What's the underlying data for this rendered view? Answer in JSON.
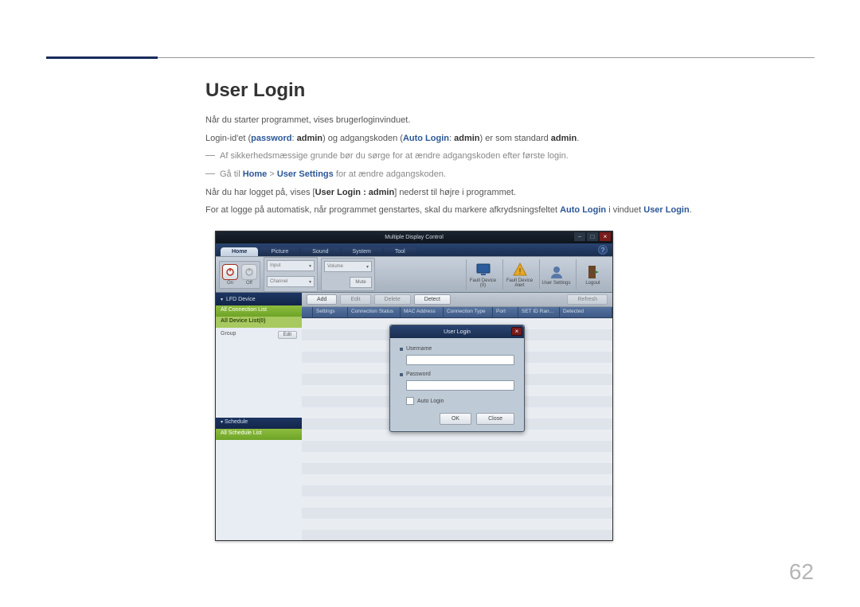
{
  "heading": "User Login",
  "intro": {
    "p1": "Når du starter programmet, vises brugerloginvinduet.",
    "p2": {
      "prefix": "Login-id'et (",
      "pw_label": "password",
      "colon1": ": ",
      "admin1": "admin",
      "mid": ") og adgangskoden (",
      "al_label": "Auto Login",
      "colon2": ": ",
      "admin2": "admin",
      "mid2": ") er som standard ",
      "admin3": "admin",
      "end": "."
    },
    "note1": "Af sikkerhedsmæssige grunde bør du sørge for at ændre adgangskoden efter første login.",
    "note2": {
      "prefix": "Gå til ",
      "home": "Home",
      "gt": " > ",
      "us": "User Settings",
      "suffix": " for at ændre adgangskoden."
    },
    "p3": {
      "prefix": "Når du har logget på, vises [",
      "ul": "User Login : admin",
      "suffix": "] nederst til højre i programmet."
    },
    "p4": {
      "prefix": "For at logge på automatisk, når programmet genstartes, skal du markere afkrydsningsfeltet ",
      "al": "Auto Login",
      "mid": " i vinduet ",
      "ul": "User Login",
      "end": "."
    }
  },
  "app": {
    "title": "Multiple Display Control",
    "tabs": [
      "Home",
      "Picture",
      "Sound",
      "System",
      "Tool"
    ],
    "toolbar": {
      "on": "On",
      "off": "Off",
      "input": "Input",
      "channel": "Channel",
      "volume": "Volume",
      "mute": "Mute",
      "fault_device": "Fault Device (0)",
      "fault_alert": "Fault Device Alert",
      "user_settings": "User Settings",
      "logout": "Logout"
    },
    "sidebar": {
      "lfd": "LFD Device",
      "conn_list": "All Connection List",
      "dev_list": "All Device List(0)",
      "group": "Group",
      "edit": "Edit",
      "schedule": "Schedule",
      "all_sched": "All Schedule List"
    },
    "actions": {
      "add": "Add",
      "edit": "Edit",
      "delete": "Delete",
      "detect": "Detect",
      "refresh": "Refresh"
    },
    "columns": [
      "",
      "Settings",
      "Connection Status",
      "MAC Address",
      "Connection Type",
      "Port",
      "SET ID Ran…",
      "Detected"
    ],
    "dialog": {
      "title": "User Login",
      "username": "Username",
      "password": "Password",
      "auto_login": "Auto Login",
      "ok": "OK",
      "close": "Close"
    }
  },
  "page_number": "62"
}
